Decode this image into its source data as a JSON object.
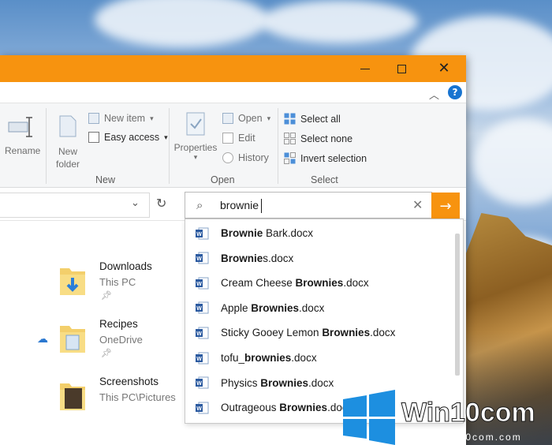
{
  "window": {
    "accent_color": "#f7930f"
  },
  "ribbon": {
    "rename_label": "Rename",
    "new_folder_label": "New folder",
    "new_item_label": "New item",
    "easy_access_label": "Easy access",
    "properties_label": "Properties",
    "open_label": "Open",
    "edit_label": "Edit",
    "history_label": "History",
    "select_all_label": "Select all",
    "select_none_label": "Select none",
    "invert_selection_label": "Invert selection",
    "groups": {
      "new": "New",
      "open": "Open",
      "select": "Select"
    }
  },
  "search": {
    "value": "brownie"
  },
  "suggestions": [
    {
      "bold": "Brownie",
      "rest": " Bark.docx",
      "pre": ""
    },
    {
      "bold": "Brownie",
      "rest": "s.docx",
      "pre": ""
    },
    {
      "pre": "Cream Cheese ",
      "bold": "Brownies",
      "rest": ".docx"
    },
    {
      "pre": "Apple ",
      "bold": "Brownies",
      "rest": ".docx"
    },
    {
      "pre": "Sticky Gooey Lemon ",
      "bold": "Brownies",
      "rest": ".docx"
    },
    {
      "pre": "tofu_",
      "bold": "brownies",
      "rest": ".docx"
    },
    {
      "pre": "Physics ",
      "bold": "Brownies",
      "rest": ".docx"
    },
    {
      "pre": "Outrageous ",
      "bold": "Brownies",
      "rest": ".docx"
    }
  ],
  "folders": [
    {
      "name": "Downloads",
      "location": "This PC"
    },
    {
      "name": "Recipes",
      "location": "OneDrive"
    },
    {
      "name": "Screenshots",
      "location": "This PC\\Pictures"
    }
  ],
  "watermark": {
    "brand": "Win10com",
    "url": "www.win10com.com"
  }
}
